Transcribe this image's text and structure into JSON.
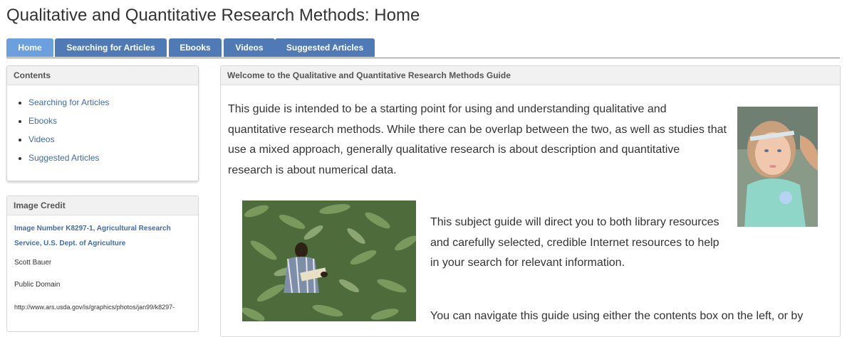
{
  "page": {
    "title": "Qualitative and Quantitative Research Methods: Home"
  },
  "tabs": [
    {
      "label": "Home",
      "active": true
    },
    {
      "label": "Searching for Articles",
      "active": false
    },
    {
      "label": "Ebooks",
      "active": false
    },
    {
      "label": "Videos",
      "active": false
    },
    {
      "label": "Suggested Articles",
      "active": false
    }
  ],
  "contents_box": {
    "heading": "Contents",
    "items": [
      {
        "label": "Searching for Articles"
      },
      {
        "label": "Ebooks"
      },
      {
        "label": "Videos"
      },
      {
        "label": "Suggested Articles"
      }
    ]
  },
  "image_credit": {
    "heading": "Image Credit",
    "source_link": "Image Number K8297-1, Agricultural Research Service, U.S. Dept. of Agriculture",
    "photographer": "Scott Bauer",
    "license": "Public Domain",
    "url_text": "http://www.ars.usda.gov/is/graphics/photos/jan99/k8297-"
  },
  "main_box": {
    "heading": "Welcome to the Qualitative and Quantitative Research Methods Guide",
    "paragraph1": "This guide is intended to be a starting point for using and understanding qualitative and quantitative research methods.  While there can be overlap between the two, as well as studies that use a mixed approach, generally qualitative research is about description and quantitative research is about numerical data.",
    "paragraph2": "This subject guide will direct you to both library resources and carefully selected, credible Internet resources to help in your search for relevant information.",
    "paragraph3": "You can navigate this guide using either the contents box on the left, or by"
  },
  "images": {
    "child_photo": "child-with-measuring-tape-photo",
    "field_photo": "researcher-in-field-photo"
  },
  "colors": {
    "tab_bg": "#4f7ab6",
    "tab_active_bg": "#6b9fdd",
    "link": "#3f6ca6"
  }
}
